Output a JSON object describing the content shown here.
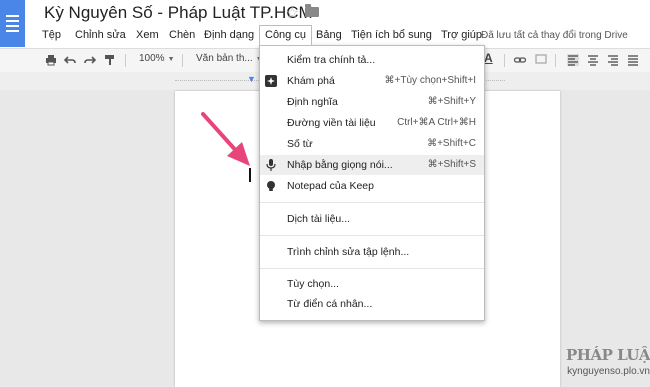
{
  "doc": {
    "title": "Kỳ Nguyên Số - Pháp Luật TP.HCM",
    "save_status": "Đã lưu tất cả thay đổi trong Drive"
  },
  "menubar": {
    "items": [
      "Tệp",
      "Chỉnh sửa",
      "Xem",
      "Chèn",
      "Định dạng",
      "Công cụ",
      "Bảng",
      "Tiện ích bổ sung",
      "Trợ giúp"
    ],
    "active": "Công cụ"
  },
  "toolbar": {
    "zoom": "100%",
    "style": "Văn bản th..."
  },
  "tools_menu": {
    "items": [
      {
        "label": "Kiểm tra chính tả...",
        "shortcut": "",
        "icon": ""
      },
      {
        "label": "Khám phá",
        "shortcut": "⌘+Tùy chọn+Shift+I",
        "icon": "explore-icon"
      },
      {
        "label": "Định nghĩa",
        "shortcut": "⌘+Shift+Y",
        "icon": ""
      },
      {
        "label": "Đường viền tài liệu",
        "shortcut": "Ctrl+⌘A Ctrl+⌘H",
        "icon": ""
      },
      {
        "label": "Số từ",
        "shortcut": "⌘+Shift+C",
        "icon": ""
      },
      {
        "label": "Nhập bằng giọng nói...",
        "shortcut": "⌘+Shift+S",
        "icon": "microphone-icon"
      },
      {
        "label": "Notepad của Keep",
        "shortcut": "",
        "icon": "lightbulb-icon"
      },
      {
        "label": "Dịch tài liệu...",
        "shortcut": "",
        "icon": ""
      },
      {
        "label": "Trình chỉnh sửa tập lệnh...",
        "shortcut": "",
        "icon": ""
      },
      {
        "label": "Tùy chọn...",
        "shortcut": "",
        "icon": ""
      },
      {
        "label": "Từ điển cá nhân...",
        "shortcut": "",
        "icon": ""
      }
    ],
    "highlighted": "Nhập bằng giọng nói..."
  },
  "watermark": {
    "brand": "PHÁP LUẬT",
    "site": "kynguyenso.plo.vn"
  },
  "colors": {
    "docs_blue": "#4a86e8",
    "arrow_pink": "#e8457a"
  }
}
